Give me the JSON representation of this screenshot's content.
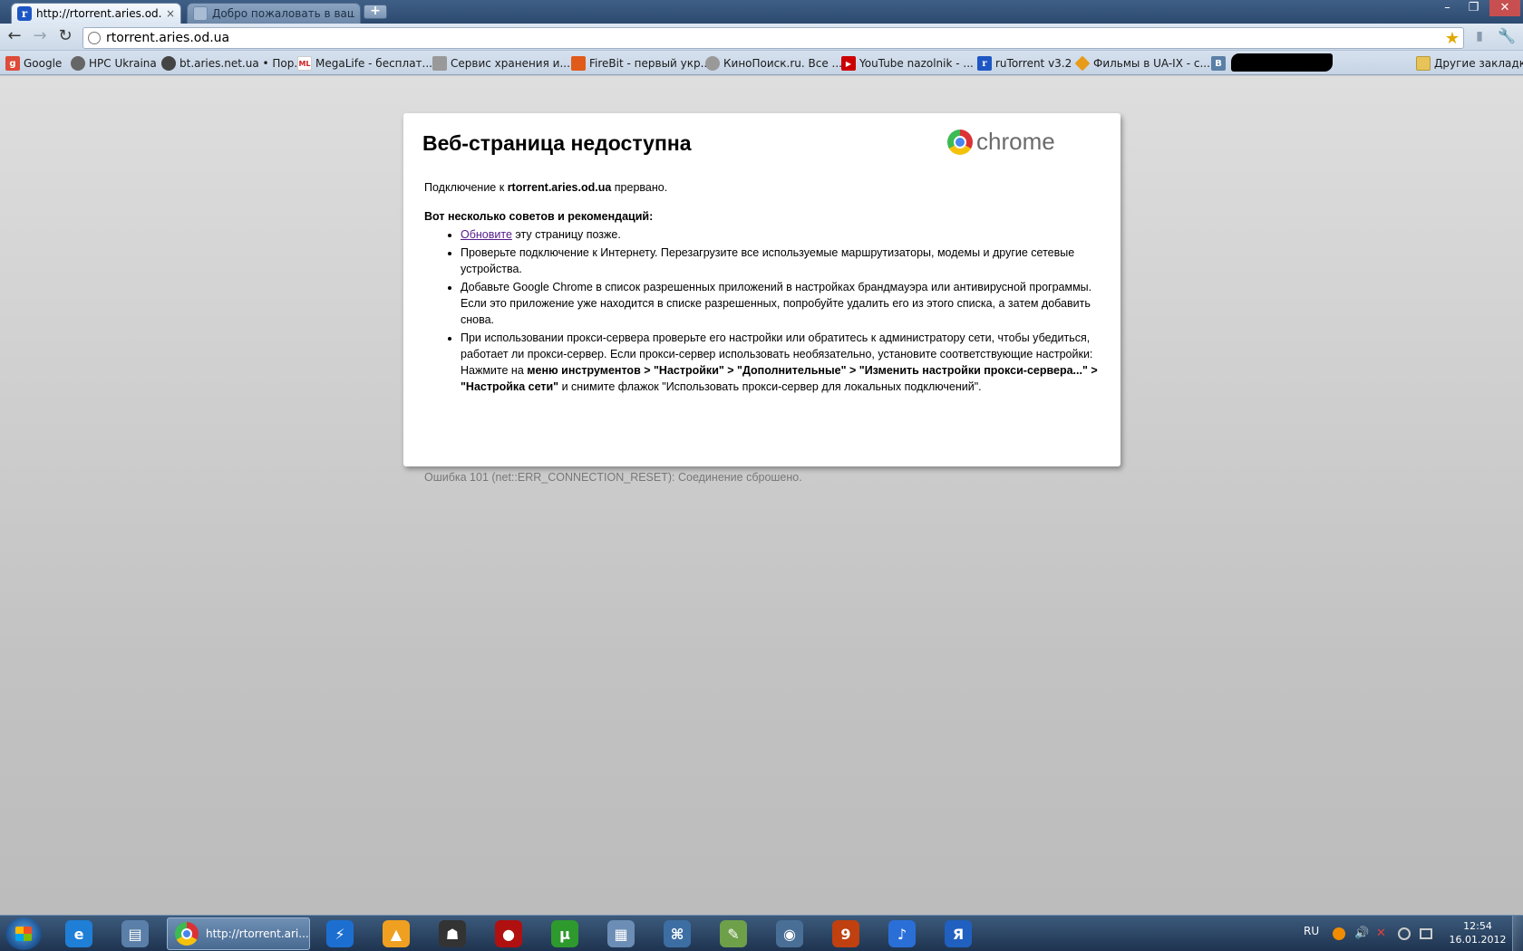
{
  "tabs": [
    {
      "title": "http://rtorrent.aries.od.ua/",
      "close": "×",
      "favicon": "r"
    },
    {
      "title": "Добро пожаловать в ваш...",
      "favicon": ""
    }
  ],
  "new_tab": "+",
  "window_controls": {
    "minimize": "–",
    "maximize": "❐",
    "close": "✕"
  },
  "nav": {
    "back": "←",
    "forward": "→",
    "reload": "↻",
    "wrench": "🔧"
  },
  "omnibox": {
    "url": "rtorrent.aries.od.ua",
    "star": "★"
  },
  "bookmarks": [
    {
      "label": "Google",
      "icon": "g",
      "color": "#dd4b39"
    },
    {
      "label": "HPC Ukraina",
      "icon": "",
      "color": "#666666"
    },
    {
      "label": "bt.aries.net.ua • Пор...",
      "icon": "",
      "color": "#444444"
    },
    {
      "label": "MegaLife - бесплат...",
      "icon": "ML",
      "color": "#cc2222"
    },
    {
      "label": "Сервис хранения и...",
      "icon": "",
      "color": "#888888"
    },
    {
      "label": "FireBit - первый укр...",
      "icon": "",
      "color": "#e05a1a"
    },
    {
      "label": "КиноПоиск.ru. Все ...",
      "icon": "",
      "color": "#999999"
    },
    {
      "label": "YouTube nazolnik - ...",
      "icon": "▶",
      "color": "#cc0000"
    },
    {
      "label": "ruTorrent v3.2",
      "icon": "r",
      "color": "#1e57c4"
    },
    {
      "label": "Фильмы в UA-IX - с...",
      "icon": "",
      "color": "#e89b19"
    },
    {
      "label": "",
      "icon": "B",
      "color": "#5b7fa6"
    }
  ],
  "other_bookmarks": "Другие закладки",
  "error": {
    "title": "Веб-страница недоступна",
    "logo_word": "chrome",
    "main_prefix": "Подключение к ",
    "main_host": "rtorrent.aries.od.ua",
    "main_suffix": " прервано.",
    "tips_heading": "Вот несколько советов и рекомендаций:",
    "tip1_link": "Обновите",
    "tip1_rest": " эту страницу позже.",
    "tip2": "Проверьте подключение к Интернету. Перезагрузите все используемые маршрутизаторы, модемы и другие сетевые устройства.",
    "tip3": "Добавьте Google Chrome в список разрешенных приложений в настройках брандмауэра или антивирусной программы. Если это приложение уже находится в списке разрешенных, попробуйте удалить его из этого списка, а затем добавить снова.",
    "tip4_a": "При использовании прокси-сервера проверьте его настройки или обратитесь к администратору сети, чтобы убедиться, работает ли прокси-сервер. Если прокси-сервер использовать необязательно, установите соответствующие настройки: Нажмите на ",
    "tip4_b": "меню инструментов > \"Настройки\" > \"Дополнительные\" > \"Изменить настройки прокси-сервера...\" > \"Настройка сети\"",
    "tip4_c": " и снимите флажок \"Использовать прокси-сервер для локальных подключений\".",
    "code": "Ошибка 101 (net::ERR_CONNECTION_RESET): Соединение сброшено."
  },
  "taskbar": {
    "chrome_label": "http://rtorrent.ari...",
    "apps": [
      {
        "name": "ie-icon",
        "glyph": "e",
        "color": "#1f7fd6"
      },
      {
        "name": "computer-icon",
        "glyph": "▤",
        "color": "#5a7fa8"
      },
      {
        "name": "torrent-launcher-icon",
        "glyph": "⚡",
        "color": "#1c6fd1"
      },
      {
        "name": "aimp-icon",
        "glyph": "▲",
        "color": "#f0a020"
      },
      {
        "name": "game-icon",
        "glyph": "☗",
        "color": "#333333"
      },
      {
        "name": "mic-icon",
        "glyph": "●",
        "color": "#b01010"
      },
      {
        "name": "utorrent-icon",
        "glyph": "µ",
        "color": "#2e9a2e"
      },
      {
        "name": "calculator-icon",
        "glyph": "▦",
        "color": "#6c8db5"
      },
      {
        "name": "network-icon",
        "glyph": "⌘",
        "color": "#3d6ea3"
      },
      {
        "name": "notes-icon",
        "glyph": "✎",
        "color": "#6ea04a"
      },
      {
        "name": "globe-app-icon",
        "glyph": "◉",
        "color": "#4a6f96"
      },
      {
        "name": "bird-app-icon",
        "glyph": "9",
        "color": "#c04010"
      },
      {
        "name": "itunes-icon",
        "glyph": "♪",
        "color": "#2a6fd8"
      },
      {
        "name": "yandex-icon",
        "glyph": "Я",
        "color": "#2060c0"
      }
    ],
    "lang": "RU",
    "time": "12:54",
    "date": "16.01.2012"
  }
}
